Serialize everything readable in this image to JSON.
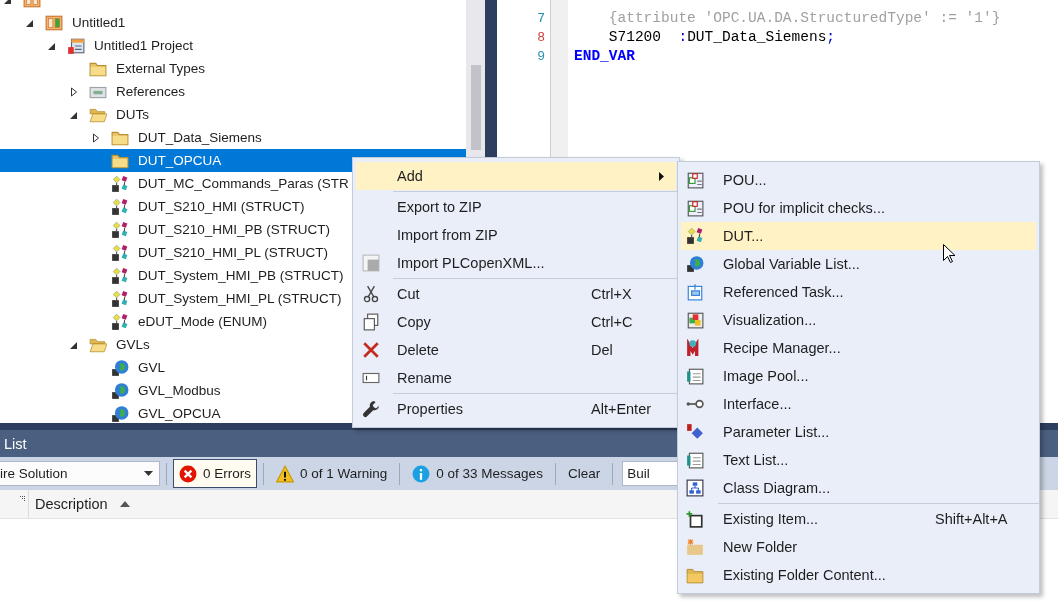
{
  "tree": {
    "items": [
      {
        "kind": "plc",
        "expanded": true,
        "selected": false,
        "children": [
          {
            "label": "Untitled1",
            "kind": "app",
            "expanded": true,
            "selected": false,
            "children": [
              {
                "label": "Untitled1 Project",
                "kind": "project",
                "expanded": true,
                "selected": false,
                "children": [
                  {
                    "label": "External Types",
                    "kind": "folder",
                    "selected": false
                  },
                  {
                    "label": "References",
                    "kind": "references",
                    "expanded": false,
                    "selected": false
                  },
                  {
                    "label": "DUTs",
                    "kind": "folder-open",
                    "expanded": true,
                    "selected": false,
                    "children": [
                      {
                        "label": "DUT_Data_Siemens",
                        "kind": "folder",
                        "expanded": false,
                        "selected": false
                      },
                      {
                        "label": "DUT_OPCUA",
                        "kind": "folder",
                        "selected": true
                      },
                      {
                        "label": "DUT_MC_Commands_Paras (STR",
                        "kind": "dut",
                        "selected": false
                      },
                      {
                        "label": "DUT_S210_HMI (STRUCT)",
                        "kind": "dut",
                        "selected": false
                      },
                      {
                        "label": "DUT_S210_HMI_PB (STRUCT)",
                        "kind": "dut",
                        "selected": false
                      },
                      {
                        "label": "DUT_S210_HMI_PL (STRUCT)",
                        "kind": "dut",
                        "selected": false
                      },
                      {
                        "label": "DUT_System_HMI_PB (STRUCT)",
                        "kind": "dut",
                        "selected": false
                      },
                      {
                        "label": "DUT_System_HMI_PL (STRUCT)",
                        "kind": "dut",
                        "selected": false
                      },
                      {
                        "label": "eDUT_Mode (ENUM)",
                        "kind": "dut",
                        "selected": false
                      }
                    ]
                  },
                  {
                    "label": "GVLs",
                    "kind": "folder-open",
                    "expanded": true,
                    "selected": false,
                    "children": [
                      {
                        "label": "GVL",
                        "kind": "gvl",
                        "selected": false
                      },
                      {
                        "label": "GVL_Modbus",
                        "kind": "gvl",
                        "selected": false
                      },
                      {
                        "label": "GVL_OPCUA",
                        "kind": "gvl",
                        "selected": false
                      }
                    ]
                  }
                ]
              }
            ]
          }
        ]
      }
    ]
  },
  "editor": {
    "lines": [
      {
        "number": "7",
        "marked": false,
        "segments": [
          {
            "kind": "attribute",
            "text": "    {attribute 'OPC.UA.DA.StructuredType' := '1'}"
          }
        ]
      },
      {
        "number": "8",
        "marked": true,
        "segments": [
          {
            "kind": "ident",
            "text": "    S71200  "
          },
          {
            "kind": "punct",
            "text": ":"
          },
          {
            "kind": "ident",
            "text": "DUT_Data_Siemens"
          },
          {
            "kind": "punct",
            "text": ";"
          }
        ]
      },
      {
        "number": "9",
        "marked": false,
        "segments": [
          {
            "kind": "keyword",
            "text": "END_VAR"
          }
        ]
      }
    ]
  },
  "error_list": {
    "title": "List",
    "scope": "ire Solution",
    "filters": [
      {
        "kind": "error",
        "label": "0 Errors",
        "highlighted": true
      },
      {
        "kind": "warning",
        "label": "0 of 1 Warning",
        "highlighted": false
      },
      {
        "kind": "message",
        "label": "0 of 33 Messages",
        "highlighted": false
      }
    ],
    "clear": "Clear",
    "build_filter": "Buil",
    "columns": [
      {
        "label": "Description",
        "sort_ascending": true
      }
    ]
  },
  "context_menu": {
    "items": [
      {
        "kind": "plain",
        "label": "Add",
        "highlighted": true,
        "submenu": true
      },
      {
        "kind": "separator"
      },
      {
        "kind": "plain",
        "label": "Export to ZIP",
        "highlighted": false,
        "submenu": false
      },
      {
        "kind": "plain",
        "label": "Import from ZIP",
        "highlighted": false,
        "submenu": false
      },
      {
        "kind": "import",
        "label": "Import PLCopenXML...",
        "highlighted": false,
        "submenu": false
      },
      {
        "kind": "separator"
      },
      {
        "kind": "cut",
        "label": "Cut",
        "shortcut": "Ctrl+X",
        "highlighted": false,
        "submenu": false
      },
      {
        "kind": "copy",
        "label": "Copy",
        "shortcut": "Ctrl+C",
        "highlighted": false,
        "submenu": false
      },
      {
        "kind": "delete",
        "label": "Delete",
        "shortcut": "Del",
        "highlighted": false,
        "submenu": false
      },
      {
        "kind": "rename",
        "label": "Rename",
        "highlighted": false,
        "submenu": false
      },
      {
        "kind": "separator"
      },
      {
        "kind": "properties",
        "label": "Properties",
        "shortcut": "Alt+Enter",
        "highlighted": false,
        "submenu": false
      }
    ]
  },
  "add_submenu": {
    "items": [
      {
        "kind": "pou",
        "label": "POU...",
        "highlighted": false
      },
      {
        "kind": "pou",
        "label": "POU for implicit checks...",
        "highlighted": false
      },
      {
        "kind": "dut",
        "label": "DUT...",
        "highlighted": true
      },
      {
        "kind": "gvl",
        "label": "Global Variable List...",
        "highlighted": false
      },
      {
        "kind": "task",
        "label": "Referenced Task...",
        "highlighted": false
      },
      {
        "kind": "visu",
        "label": "Visualization...",
        "highlighted": false
      },
      {
        "kind": "recipe",
        "label": "Recipe Manager...",
        "highlighted": false
      },
      {
        "kind": "imagepool",
        "label": "Image Pool...",
        "highlighted": false
      },
      {
        "kind": "interface",
        "label": "Interface...",
        "highlighted": false
      },
      {
        "kind": "paramlist",
        "label": "Parameter List...",
        "highlighted": false
      },
      {
        "kind": "textlist",
        "label": "Text List...",
        "highlighted": false
      },
      {
        "kind": "classdiagram",
        "label": "Class Diagram...",
        "highlighted": false
      },
      {
        "kind": "separator"
      },
      {
        "kind": "existing-item",
        "label": "Existing Item...",
        "shortcut": "Shift+Alt+A",
        "highlighted": false
      },
      {
        "kind": "new-folder",
        "label": "New Folder",
        "highlighted": false
      },
      {
        "kind": "folder-content",
        "label": "Existing Folder Content...",
        "highlighted": false
      }
    ]
  }
}
